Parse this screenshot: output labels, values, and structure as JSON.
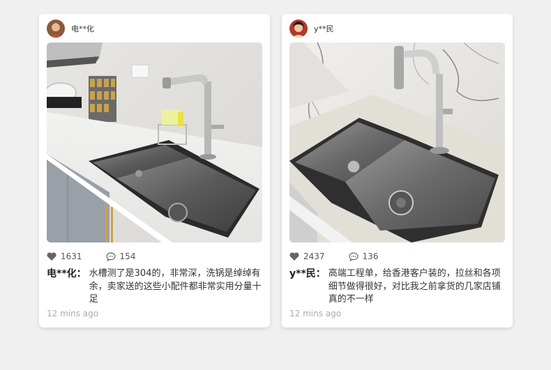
{
  "posts": [
    {
      "username": "电**化",
      "likes": "1631",
      "comments": "154",
      "comment_author": "电**化：",
      "comment_text": "水槽测了是304的，非常深，洗锅是绰绰有余，卖家送的这些小配件都非常实用分量十足",
      "time": "12 mins ago"
    },
    {
      "username": "y**民",
      "likes": "2437",
      "comments": "136",
      "comment_author": "y**民：",
      "comment_text": "高端工程单，给香港客户装的，拉丝和各项细节做得很好，对比我之前拿货的几家店铺真的不一样",
      "time": "12 mins ago"
    }
  ],
  "icons": {
    "like": "heart-icon",
    "comment": "speech-bubble-icon"
  },
  "colors": {
    "background": "#f0f0f0",
    "card": "#ffffff",
    "text": "#333333",
    "muted": "#aaaaaa"
  }
}
